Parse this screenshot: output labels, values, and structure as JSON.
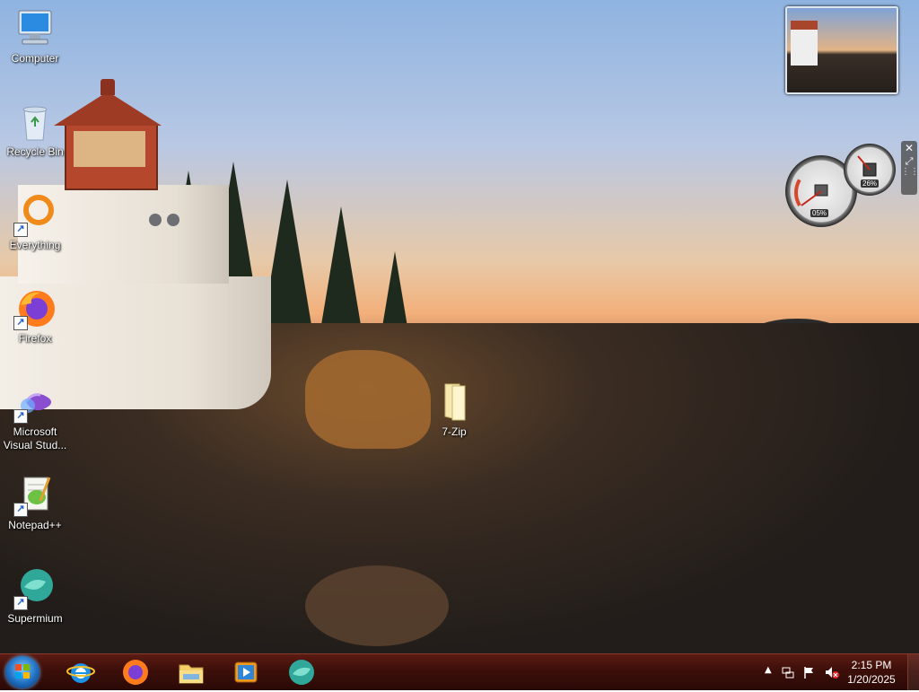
{
  "desktop": {
    "icons": [
      {
        "label": "Computer",
        "icon": "computer-icon"
      },
      {
        "label": "Recycle Bin",
        "icon": "recycle-bin-icon"
      },
      {
        "label": "Everything",
        "icon": "everything-icon",
        "shortcut": true
      },
      {
        "label": "Firefox",
        "icon": "firefox-icon",
        "shortcut": true
      },
      {
        "label": "Microsoft Visual Stud...",
        "icon": "visual-studio-icon",
        "shortcut": true
      },
      {
        "label": "Notepad++",
        "icon": "notepad-plus-plus-icon",
        "shortcut": true
      },
      {
        "label": "Supermium",
        "icon": "supermium-icon",
        "shortcut": true
      },
      {
        "label": "7-Zip",
        "icon": "folder-icon"
      }
    ]
  },
  "gadgets": {
    "cpu_gauge": {
      "label": "05%",
      "value": 5
    },
    "memory_gauge": {
      "label": "26%",
      "value": 26
    }
  },
  "taskbar": {
    "pinned": [
      {
        "name": "Internet Explorer",
        "icon": "internet-explorer-icon"
      },
      {
        "name": "Firefox",
        "icon": "firefox-icon"
      },
      {
        "name": "File Explorer",
        "icon": "file-explorer-icon"
      },
      {
        "name": "Media Player",
        "icon": "media-player-icon"
      },
      {
        "name": "Supermium",
        "icon": "supermium-icon"
      }
    ],
    "clock": {
      "time": "2:15 PM",
      "date": "1/20/2025"
    }
  },
  "colors": {
    "taskbar": "#3d0f0a",
    "start_orb": "#1f6fc2",
    "sky": "#b8c8e4"
  }
}
